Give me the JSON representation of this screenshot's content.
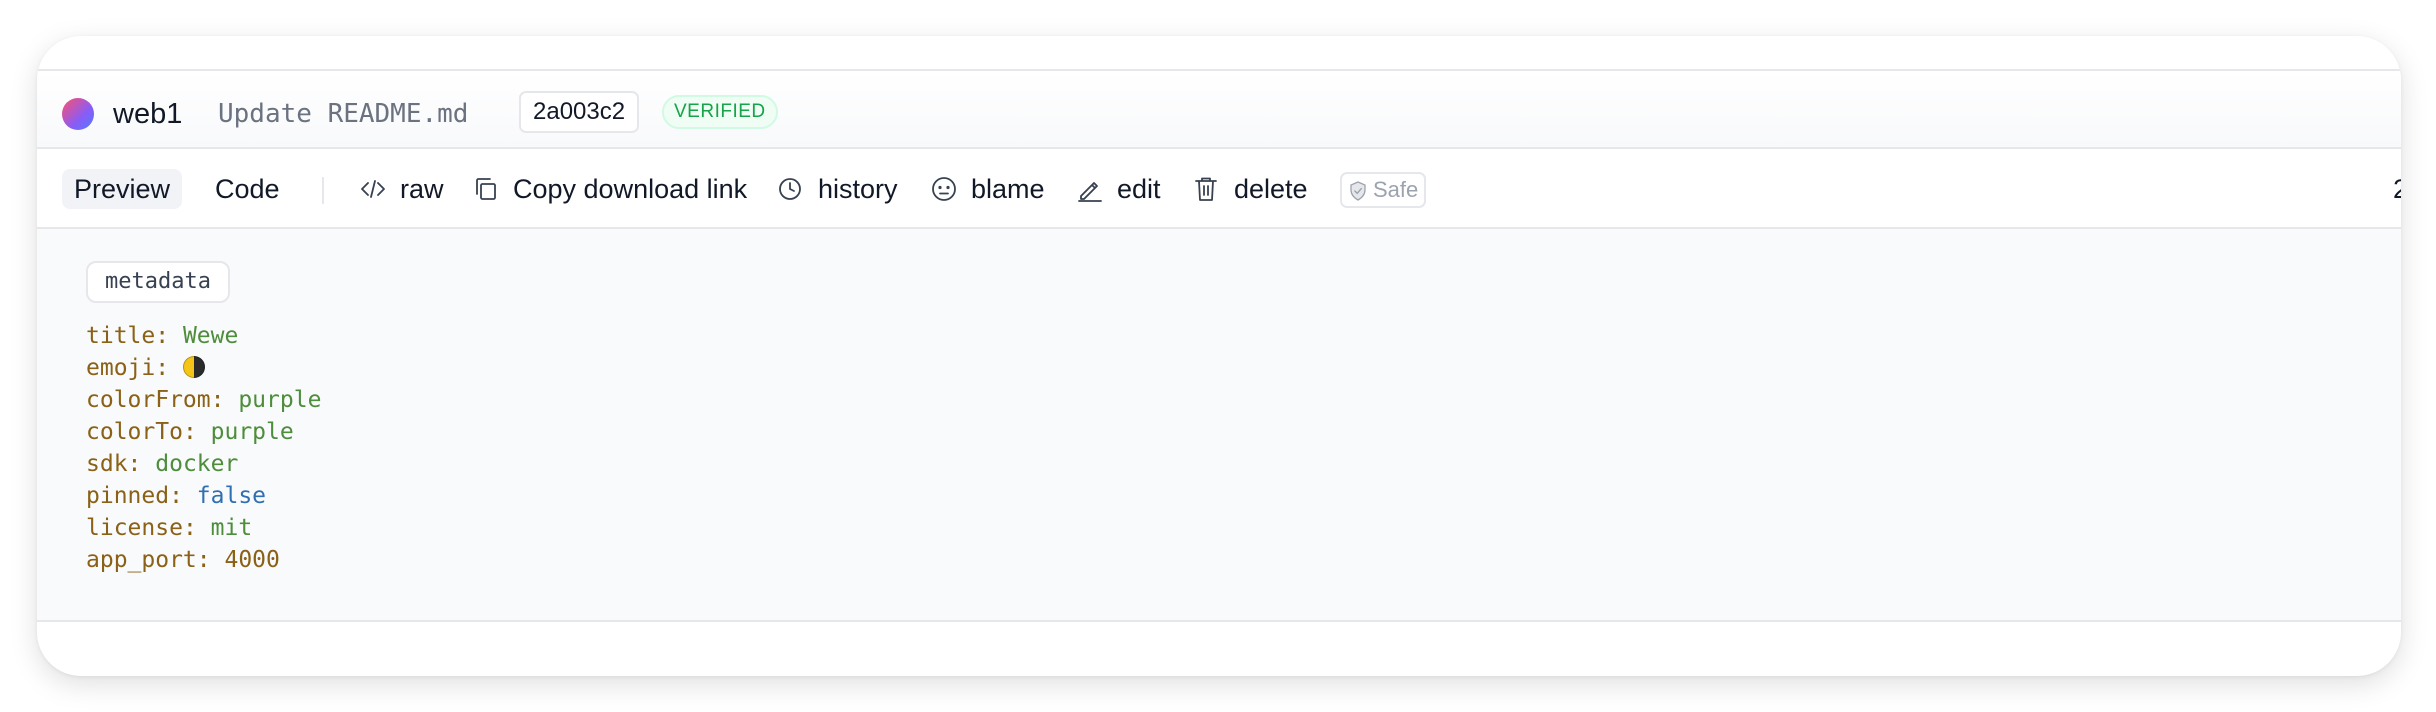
{
  "header": {
    "repo_name": "web1",
    "commit_message": "Update README.md",
    "commit_sha": "2a003c2",
    "verified_label": "VERIFIED",
    "avatar_colors": [
      "#ff4f6d",
      "#8a5cf6",
      "#4f7dff"
    ]
  },
  "toolbar": {
    "tab_preview": "Preview",
    "tab_code": "Code",
    "raw_label": "raw",
    "copy_link_label": "Copy download link",
    "history_label": "history",
    "blame_label": "blame",
    "edit_label": "edit",
    "delete_label": "delete",
    "safe_label": "Safe",
    "overflow_text": "2"
  },
  "metadata": {
    "chip_label": "metadata",
    "entries": [
      {
        "key": "title",
        "value": "Wewe",
        "type": "string"
      },
      {
        "key": "emoji",
        "value": "🌓",
        "type": "emoji"
      },
      {
        "key": "colorFrom",
        "value": "purple",
        "type": "string"
      },
      {
        "key": "colorTo",
        "value": "purple",
        "type": "string"
      },
      {
        "key": "sdk",
        "value": "docker",
        "type": "string"
      },
      {
        "key": "pinned",
        "value": "false",
        "type": "boolean"
      },
      {
        "key": "license",
        "value": "mit",
        "type": "string"
      },
      {
        "key": "app_port",
        "value": "4000",
        "type": "number"
      }
    ]
  },
  "colors": {
    "yaml_key": "#8a6116",
    "yaml_string": "#4d8d3b",
    "yaml_boolean": "#2f6fb4",
    "verified_green": "#16a34a"
  },
  "icons": {
    "raw": "code-icon",
    "copy": "copy-icon",
    "history": "clock-icon",
    "blame": "face-icon",
    "edit": "pencil-icon",
    "delete": "trash-icon",
    "safe": "shield-check-icon"
  }
}
